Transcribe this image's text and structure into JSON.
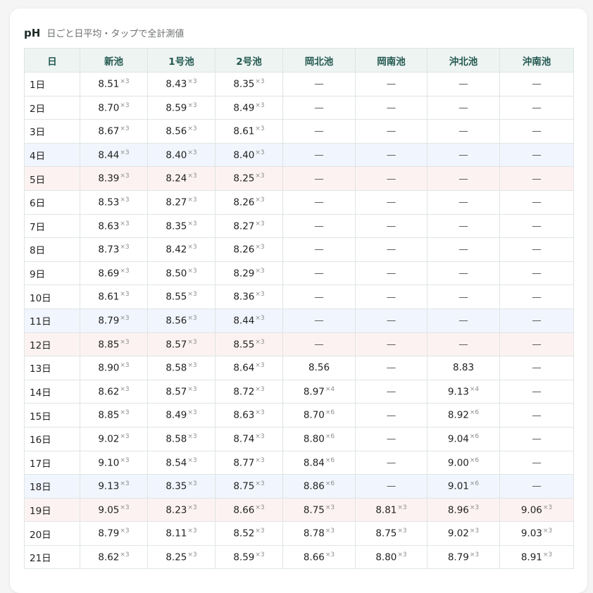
{
  "header": {
    "title": "pH",
    "subtitle": "日ごと日平均・タップで全計測値"
  },
  "columns": [
    "日",
    "新池",
    "1号池",
    "2号池",
    "岡北池",
    "岡南池",
    "沖北池",
    "沖南池"
  ],
  "rows": [
    {
      "day": "1日",
      "highlight": "",
      "cells": [
        [
          "8.51",
          "×3"
        ],
        [
          "8.43",
          "×3"
        ],
        [
          "8.35",
          "×3"
        ],
        [
          "—",
          ""
        ],
        [
          "—",
          ""
        ],
        [
          "—",
          ""
        ],
        [
          "—",
          ""
        ]
      ]
    },
    {
      "day": "2日",
      "highlight": "",
      "cells": [
        [
          "8.70",
          "×3"
        ],
        [
          "8.59",
          "×3"
        ],
        [
          "8.49",
          "×3"
        ],
        [
          "—",
          ""
        ],
        [
          "—",
          ""
        ],
        [
          "—",
          ""
        ],
        [
          "—",
          ""
        ]
      ]
    },
    {
      "day": "3日",
      "highlight": "",
      "cells": [
        [
          "8.67",
          "×3"
        ],
        [
          "8.56",
          "×3"
        ],
        [
          "8.61",
          "×3"
        ],
        [
          "—",
          ""
        ],
        [
          "—",
          ""
        ],
        [
          "—",
          ""
        ],
        [
          "—",
          ""
        ]
      ]
    },
    {
      "day": "4日",
      "highlight": "sat",
      "cells": [
        [
          "8.44",
          "×3"
        ],
        [
          "8.40",
          "×3"
        ],
        [
          "8.40",
          "×3"
        ],
        [
          "—",
          ""
        ],
        [
          "—",
          ""
        ],
        [
          "—",
          ""
        ],
        [
          "—",
          ""
        ]
      ]
    },
    {
      "day": "5日",
      "highlight": "sun",
      "cells": [
        [
          "8.39",
          "×3"
        ],
        [
          "8.24",
          "×3"
        ],
        [
          "8.25",
          "×3"
        ],
        [
          "—",
          ""
        ],
        [
          "—",
          ""
        ],
        [
          "—",
          ""
        ],
        [
          "—",
          ""
        ]
      ]
    },
    {
      "day": "6日",
      "highlight": "",
      "cells": [
        [
          "8.53",
          "×3"
        ],
        [
          "8.27",
          "×3"
        ],
        [
          "8.26",
          "×3"
        ],
        [
          "—",
          ""
        ],
        [
          "—",
          ""
        ],
        [
          "—",
          ""
        ],
        [
          "—",
          ""
        ]
      ]
    },
    {
      "day": "7日",
      "highlight": "",
      "cells": [
        [
          "8.63",
          "×3"
        ],
        [
          "8.35",
          "×3"
        ],
        [
          "8.27",
          "×3"
        ],
        [
          "—",
          ""
        ],
        [
          "—",
          ""
        ],
        [
          "—",
          ""
        ],
        [
          "—",
          ""
        ]
      ]
    },
    {
      "day": "8日",
      "highlight": "",
      "cells": [
        [
          "8.73",
          "×3"
        ],
        [
          "8.42",
          "×3"
        ],
        [
          "8.26",
          "×3"
        ],
        [
          "—",
          ""
        ],
        [
          "—",
          ""
        ],
        [
          "—",
          ""
        ],
        [
          "—",
          ""
        ]
      ]
    },
    {
      "day": "9日",
      "highlight": "",
      "cells": [
        [
          "8.69",
          "×3"
        ],
        [
          "8.50",
          "×3"
        ],
        [
          "8.29",
          "×3"
        ],
        [
          "—",
          ""
        ],
        [
          "—",
          ""
        ],
        [
          "—",
          ""
        ],
        [
          "—",
          ""
        ]
      ]
    },
    {
      "day": "10日",
      "highlight": "",
      "cells": [
        [
          "8.61",
          "×3"
        ],
        [
          "8.55",
          "×3"
        ],
        [
          "8.36",
          "×3"
        ],
        [
          "—",
          ""
        ],
        [
          "—",
          ""
        ],
        [
          "—",
          ""
        ],
        [
          "—",
          ""
        ]
      ]
    },
    {
      "day": "11日",
      "highlight": "sat",
      "cells": [
        [
          "8.79",
          "×3"
        ],
        [
          "8.56",
          "×3"
        ],
        [
          "8.44",
          "×3"
        ],
        [
          "—",
          ""
        ],
        [
          "—",
          ""
        ],
        [
          "—",
          ""
        ],
        [
          "—",
          ""
        ]
      ]
    },
    {
      "day": "12日",
      "highlight": "sun",
      "cells": [
        [
          "8.85",
          "×3"
        ],
        [
          "8.57",
          "×3"
        ],
        [
          "8.55",
          "×3"
        ],
        [
          "—",
          ""
        ],
        [
          "—",
          ""
        ],
        [
          "—",
          ""
        ],
        [
          "—",
          ""
        ]
      ]
    },
    {
      "day": "13日",
      "highlight": "",
      "cells": [
        [
          "8.90",
          "×3"
        ],
        [
          "8.58",
          "×3"
        ],
        [
          "8.64",
          "×3"
        ],
        [
          "8.56",
          ""
        ],
        [
          "—",
          ""
        ],
        [
          "8.83",
          ""
        ],
        [
          "—",
          ""
        ]
      ]
    },
    {
      "day": "14日",
      "highlight": "",
      "cells": [
        [
          "8.62",
          "×3"
        ],
        [
          "8.57",
          "×3"
        ],
        [
          "8.72",
          "×3"
        ],
        [
          "8.97",
          "×4"
        ],
        [
          "—",
          ""
        ],
        [
          "9.13",
          "×4"
        ],
        [
          "—",
          ""
        ]
      ]
    },
    {
      "day": "15日",
      "highlight": "",
      "cells": [
        [
          "8.85",
          "×3"
        ],
        [
          "8.49",
          "×3"
        ],
        [
          "8.63",
          "×3"
        ],
        [
          "8.70",
          "×6"
        ],
        [
          "—",
          ""
        ],
        [
          "8.92",
          "×6"
        ],
        [
          "—",
          ""
        ]
      ]
    },
    {
      "day": "16日",
      "highlight": "",
      "cells": [
        [
          "9.02",
          "×3"
        ],
        [
          "8.58",
          "×3"
        ],
        [
          "8.74",
          "×3"
        ],
        [
          "8.80",
          "×6"
        ],
        [
          "—",
          ""
        ],
        [
          "9.04",
          "×6"
        ],
        [
          "—",
          ""
        ]
      ]
    },
    {
      "day": "17日",
      "highlight": "",
      "cells": [
        [
          "9.10",
          "×3"
        ],
        [
          "8.54",
          "×3"
        ],
        [
          "8.77",
          "×3"
        ],
        [
          "8.84",
          "×6"
        ],
        [
          "—",
          ""
        ],
        [
          "9.00",
          "×6"
        ],
        [
          "—",
          ""
        ]
      ]
    },
    {
      "day": "18日",
      "highlight": "sat",
      "cells": [
        [
          "9.13",
          "×3"
        ],
        [
          "8.35",
          "×3"
        ],
        [
          "8.75",
          "×3"
        ],
        [
          "8.86",
          "×6"
        ],
        [
          "—",
          ""
        ],
        [
          "9.01",
          "×6"
        ],
        [
          "—",
          ""
        ]
      ]
    },
    {
      "day": "19日",
      "highlight": "sun",
      "cells": [
        [
          "9.05",
          "×3"
        ],
        [
          "8.23",
          "×3"
        ],
        [
          "8.66",
          "×3"
        ],
        [
          "8.75",
          "×3"
        ],
        [
          "8.81",
          "×3"
        ],
        [
          "8.96",
          "×3"
        ],
        [
          "9.06",
          "×3"
        ]
      ]
    },
    {
      "day": "20日",
      "highlight": "",
      "cells": [
        [
          "8.79",
          "×3"
        ],
        [
          "8.11",
          "×3"
        ],
        [
          "8.52",
          "×3"
        ],
        [
          "8.78",
          "×3"
        ],
        [
          "8.75",
          "×3"
        ],
        [
          "9.02",
          "×3"
        ],
        [
          "9.03",
          "×3"
        ]
      ]
    },
    {
      "day": "21日",
      "highlight": "",
      "cells": [
        [
          "8.62",
          "×3"
        ],
        [
          "8.25",
          "×3"
        ],
        [
          "8.59",
          "×3"
        ],
        [
          "8.66",
          "×3"
        ],
        [
          "8.80",
          "×3"
        ],
        [
          "8.79",
          "×3"
        ],
        [
          "8.91",
          "×3"
        ]
      ]
    }
  ]
}
